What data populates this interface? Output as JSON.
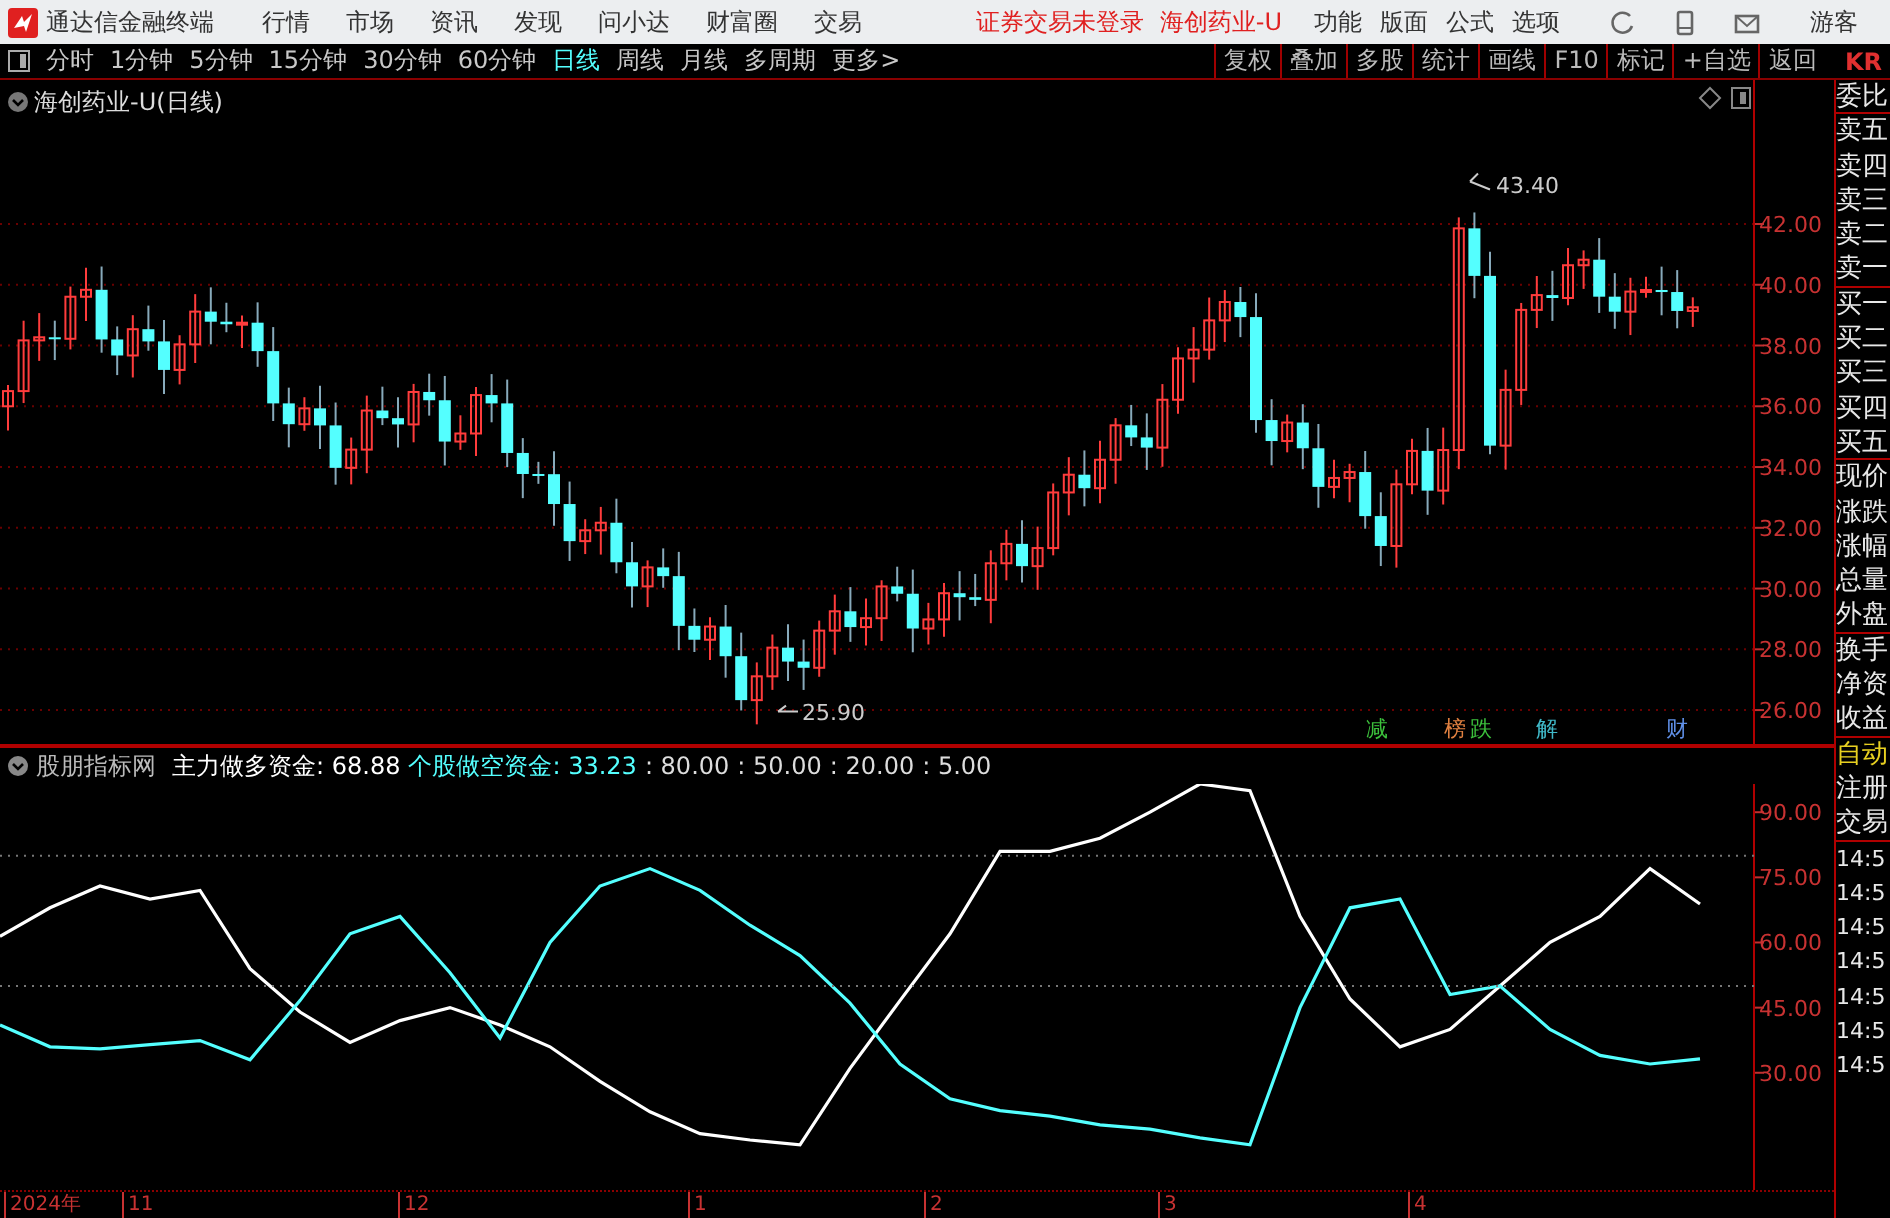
{
  "title_bar": {
    "app_title": "通达信金融终端",
    "menus": [
      "行情",
      "市场",
      "资讯",
      "发现",
      "问小达",
      "财富圈",
      "交易"
    ],
    "login_status": "证券交易未登录",
    "stock_name": "海创药业-U",
    "right_menus": [
      "功能",
      "版面",
      "公式",
      "选项"
    ],
    "user": "游客"
  },
  "toolbar": {
    "periods": [
      {
        "label": "分时",
        "selected": false
      },
      {
        "label": "1分钟",
        "selected": false
      },
      {
        "label": "5分钟",
        "selected": false
      },
      {
        "label": "15分钟",
        "selected": false
      },
      {
        "label": "30分钟",
        "selected": false
      },
      {
        "label": "60分钟",
        "selected": false
      },
      {
        "label": "日线",
        "selected": true
      },
      {
        "label": "周线",
        "selected": false
      },
      {
        "label": "月线",
        "selected": false
      },
      {
        "label": "多周期",
        "selected": false
      },
      {
        "label": "更多>",
        "selected": false
      }
    ],
    "buttons": [
      "复权",
      "叠加",
      "多股",
      "统计",
      "画线",
      "F10",
      "标记",
      "+自选",
      "返回"
    ],
    "corner_text": "KR"
  },
  "main_chart": {
    "title": "海创药业-U(日线)",
    "high_label": "43.40",
    "low_label": "25.90",
    "axis_labels": [
      "42.00",
      "40.00",
      "38.00",
      "36.00",
      "34.00",
      "32.00",
      "30.00",
      "28.00",
      "26.00"
    ],
    "event_markers": [
      {
        "text": "减",
        "color": "#3cc03c"
      },
      {
        "text": "榜",
        "color": "#e08040"
      },
      {
        "text": "跌",
        "color": "#3cc03c"
      },
      {
        "text": "解",
        "color": "#40b8c8"
      },
      {
        "text": "财",
        "color": "#6090e8"
      }
    ]
  },
  "indicator": {
    "name": "股朋指标网",
    "readouts": [
      ": 68.88",
      ": 33.23"
    ],
    "params": [
      ": 80.00",
      ": 50.00",
      ": 20.00",
      ": 5.00"
    ],
    "chart_data": {
      "type": "line",
      "ylim": [
        3,
        96.5
      ],
      "yticks": [
        {
          "value": 90,
          "label": "90.00"
        },
        {
          "value": 75,
          "label": "75.00"
        },
        {
          "value": 60,
          "label": "60.00"
        },
        {
          "value": 45,
          "label": "45.00"
        },
        {
          "value": 30,
          "label": "30.00"
        }
      ],
      "series": [
        {
          "name": "主力做多资金",
          "color": "#ffffff",
          "values": [
            61.4,
            68,
            73,
            70,
            72,
            54,
            44,
            37,
            42,
            45,
            41,
            36,
            28,
            21,
            16,
            14.5,
            13.4,
            31,
            46.6,
            62,
            81,
            81,
            84,
            90,
            96.5,
            95,
            66,
            47,
            36,
            40,
            50,
            60,
            66,
            77,
            68.88
          ]
        },
        {
          "name": "个股做空资金",
          "color": "#54ffff",
          "values": [
            41,
            36,
            35.5,
            36.5,
            37.4,
            33,
            46.6,
            62,
            66,
            53,
            38,
            60,
            73,
            77,
            72,
            64,
            57,
            46,
            32,
            24,
            21.3,
            20,
            18,
            17,
            15,
            13.4,
            45,
            68,
            70,
            48,
            50,
            40,
            34,
            32,
            33.23
          ]
        }
      ]
    }
  },
  "date_axis": [
    "2024年",
    "11",
    "12",
    "1",
    "2",
    "3",
    "4"
  ],
  "side_panel": {
    "groups": [
      [
        {
          "text": "委比",
          "highlighted": false
        }
      ],
      [
        {
          "text": "卖五",
          "highlighted": false
        },
        {
          "text": "卖四",
          "highlighted": false
        },
        {
          "text": "卖三",
          "highlighted": false
        },
        {
          "text": "卖二",
          "highlighted": false
        },
        {
          "text": "卖一",
          "highlighted": false
        }
      ],
      [
        {
          "text": "买一",
          "highlighted": false
        },
        {
          "text": "买二",
          "highlighted": false
        },
        {
          "text": "买三",
          "highlighted": false
        },
        {
          "text": "买四",
          "highlighted": false
        },
        {
          "text": "买五",
          "highlighted": false
        }
      ],
      [
        {
          "text": "现价",
          "highlighted": false
        },
        {
          "text": "涨跌",
          "highlighted": false
        },
        {
          "text": "涨幅",
          "highlighted": false
        },
        {
          "text": "总量",
          "highlighted": false
        },
        {
          "text": "外盘",
          "highlighted": false
        }
      ],
      [
        {
          "text": "换手",
          "highlighted": false
        },
        {
          "text": "净资",
          "highlighted": false
        },
        {
          "text": "收益",
          "highlighted": false
        }
      ],
      [
        {
          "text": "自动",
          "highlighted": true
        },
        {
          "text": "注册",
          "highlighted": false
        },
        {
          "text": "交易",
          "highlighted": false
        }
      ],
      [
        {
          "text": "14:5",
          "highlighted": false
        },
        {
          "text": "14:5",
          "highlighted": false
        },
        {
          "text": "14:5",
          "highlighted": false
        },
        {
          "text": "14:5",
          "highlighted": false
        },
        {
          "text": "14:5",
          "highlighted": false
        },
        {
          "text": "14:5",
          "highlighted": false
        },
        {
          "text": "14:5",
          "highlighted": false
        }
      ]
    ]
  }
}
